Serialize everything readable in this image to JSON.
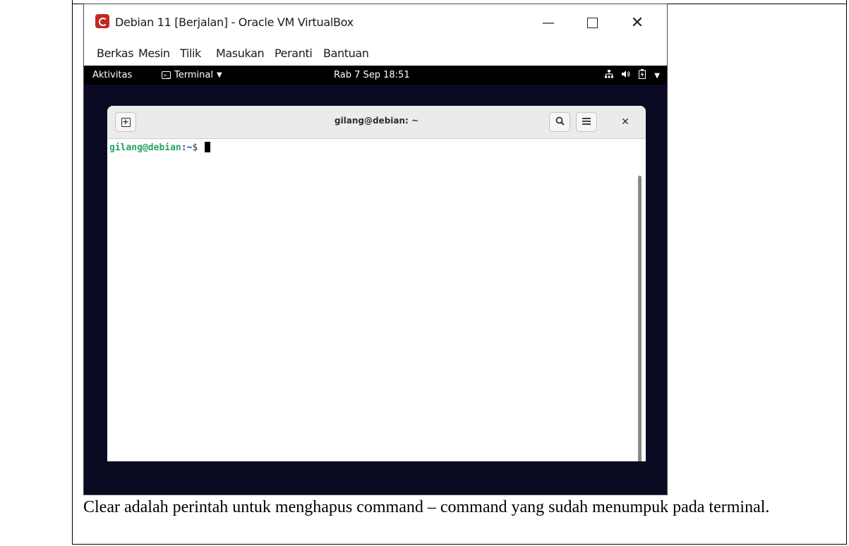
{
  "window": {
    "title": "Debian 11 [Berjalan] - Oracle VM VirtualBox",
    "minimize": "—",
    "close": "✕"
  },
  "menubar": {
    "items": [
      "Berkas",
      "Mesin",
      "Tilik",
      "Masukan",
      "Peranti",
      "Bantuan"
    ]
  },
  "gnome_topbar": {
    "activities": "Aktivitas",
    "app_menu": "Terminal",
    "clock": "Rab 7 Sep 18:51",
    "icons": [
      "network-icon",
      "volume-icon",
      "battery-icon",
      "system-menu-icon"
    ]
  },
  "terminal": {
    "title": "gilang@debian: ~",
    "prompt_user": "gilang@debian",
    "prompt_path": ":~",
    "prompt_symbol": "$ "
  },
  "caption": {
    "text": "Clear adalah perintah untuk menghapus command – command yang sudah menumpuk pada terminal."
  },
  "colors": {
    "guest_bg": "#0b0a23",
    "prompt_user": "#26a269",
    "prompt_path": "#12488b"
  }
}
